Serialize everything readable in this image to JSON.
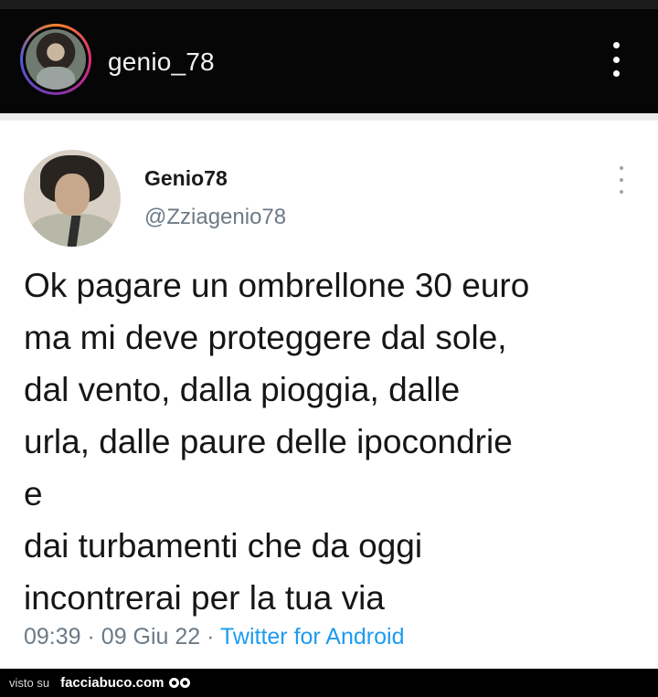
{
  "instagram": {
    "username": "genio_78",
    "menu_icon": "more-vertical-icon"
  },
  "tweet": {
    "display_name": "Genio78",
    "handle": "@Zziagenio78",
    "menu_icon": "more-vertical-icon",
    "text": "Ok pagare un ombrellone 30 euro\nma mi deve proteggere dal sole,\ndal vento, dalla pioggia, dalle\nurla, dalle paure delle ipocondrie\ne\ndai turbamenti che da oggi\nincontrerai per la tua via",
    "time": "09:39",
    "separator": "·",
    "date": "09 Giu 22",
    "source": "Twitter for Android"
  },
  "watermark": {
    "prefix": "visto su",
    "site": "facciabuco.com",
    "logo_icon": "eyes-logo-icon"
  },
  "colors": {
    "header_bg": "#060606",
    "card_bg": "#ffffff",
    "link": "#1d9bf0",
    "secondary_text": "#6c7a86"
  }
}
